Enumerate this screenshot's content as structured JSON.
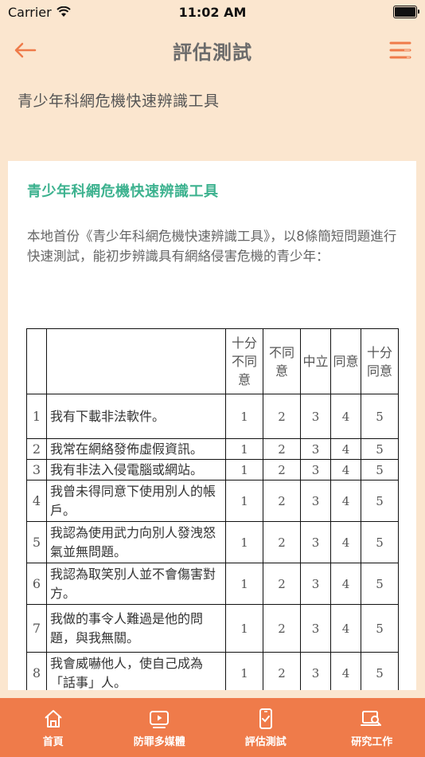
{
  "status_bar": {
    "carrier": "Carrier",
    "time": "11:02 AM"
  },
  "nav": {
    "title": "評估測試"
  },
  "subtitle": "青少年科網危機快速辨識工具",
  "card": {
    "title": "青少年科網危機快速辨識工具",
    "intro": "本地首份《青少年科網危機快速辨識工具》，以8條簡短問題進行快速測試，能初步辨識具有網絡侵害危機的青少年："
  },
  "table": {
    "headers": [
      "十分\n不同\n意",
      "不同\n意",
      "中立",
      "同意",
      "十分\n同意"
    ],
    "rows": [
      {
        "num": "1",
        "text": "我有下載非法軟件。",
        "values": [
          "1",
          "2",
          "3",
          "4",
          "5"
        ]
      },
      {
        "num": "2",
        "text": "我常在網絡發佈虛假資訊。",
        "values": [
          "1",
          "2",
          "3",
          "4",
          "5"
        ]
      },
      {
        "num": "3",
        "text": "我有非法入侵電腦或網站。",
        "values": [
          "1",
          "2",
          "3",
          "4",
          "5"
        ]
      },
      {
        "num": "4",
        "text": "我曾未得同意下使用別人的帳戶。",
        "values": [
          "1",
          "2",
          "3",
          "4",
          "5"
        ]
      },
      {
        "num": "5",
        "text": "我認為使用武力向別人發洩怒氣並無問題。",
        "values": [
          "1",
          "2",
          "3",
          "4",
          "5"
        ]
      },
      {
        "num": "6",
        "text": "我認為取笑別人並不會傷害對方。",
        "values": [
          "1",
          "2",
          "3",
          "4",
          "5"
        ]
      },
      {
        "num": "7",
        "text": "我做的事令人難過是他的問題，與我無關。",
        "values": [
          "1",
          "2",
          "3",
          "4",
          "5"
        ]
      },
      {
        "num": "8",
        "text": "我會威嚇他人，使自己成為「話事」人。",
        "values": [
          "1",
          "2",
          "3",
          "4",
          "5"
        ]
      }
    ]
  },
  "tabs": [
    {
      "label": "首頁",
      "icon": "home-icon"
    },
    {
      "label": "防罪多媒體",
      "icon": "video-icon"
    },
    {
      "label": "評估測試",
      "icon": "checklist-phone-icon"
    },
    {
      "label": "研究工作",
      "icon": "research-icon"
    }
  ],
  "colors": {
    "accent": "#ef7b4a",
    "background": "#fbe6cf",
    "title_green": "#3db28f"
  }
}
